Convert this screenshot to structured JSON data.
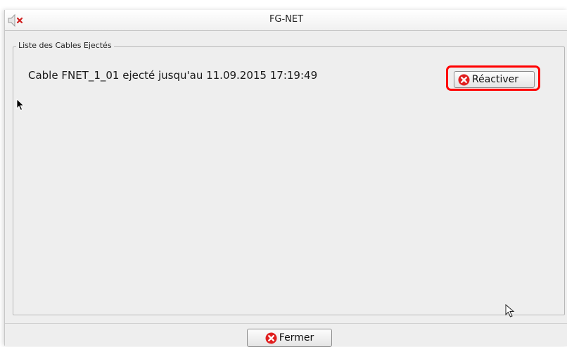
{
  "window": {
    "title": "FG-NET"
  },
  "icons": {
    "speaker": "speaker-muted-icon",
    "error": "error-x-icon",
    "pointer": "mouse-pointer-icon"
  },
  "colors": {
    "highlight": "#ff0000",
    "error_red": "#e02020",
    "background": "#eeeeee"
  },
  "cables_group": {
    "title": "Liste des Cables Ejectés",
    "items": [
      {
        "text": "Cable FNET_1_01 ejecté jusqu'au 11.09.2015 17:19:49",
        "action_label": "Réactiver"
      }
    ]
  },
  "footer": {
    "close_label": "Fermer"
  }
}
